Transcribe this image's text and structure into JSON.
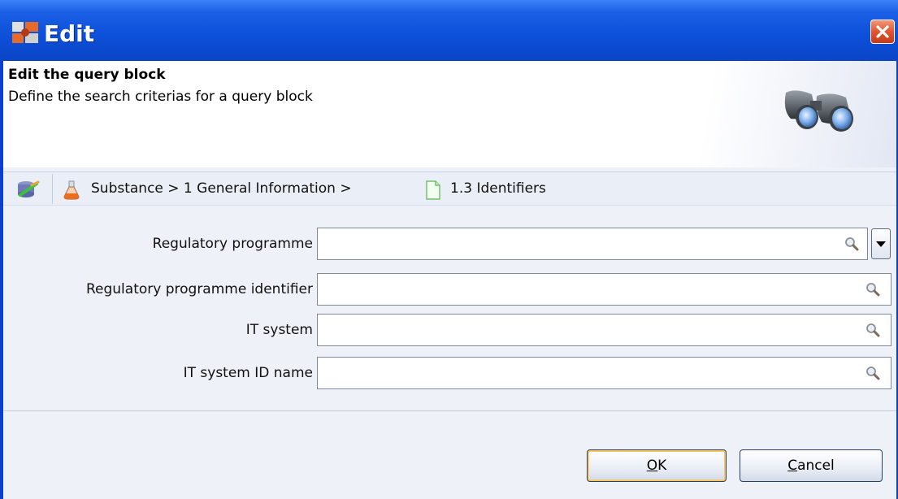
{
  "window": {
    "title": "Edit",
    "colors": {
      "titlebar": "#0c4fd8",
      "close": "#e0552f",
      "content": "#eef1f7"
    }
  },
  "header": {
    "title": "Edit the query block",
    "subtitle": "Define the search criterias for a query block"
  },
  "breadcrumb": {
    "path": "Substance > 1 General Information >",
    "current": "1.3 Identifiers"
  },
  "form": {
    "fields": [
      {
        "label": "Regulatory programme",
        "value": "",
        "has_dropdown": true
      },
      {
        "label": "Regulatory programme identifier",
        "value": ""
      },
      {
        "label": "IT system",
        "value": ""
      },
      {
        "label": "IT system ID name",
        "value": ""
      }
    ]
  },
  "buttons": {
    "ok": {
      "mnemonic": "O",
      "rest": "K"
    },
    "cancel": {
      "mnemonic": "C",
      "rest": "ancel"
    }
  },
  "icons": {
    "app": "app-logo-icon",
    "close": "close-icon",
    "binoculars": "binoculars-icon",
    "crumb_button": "database-icon",
    "flask": "flask-icon",
    "document": "document-icon",
    "search": "search-icon",
    "dropdown": "chevron-down-icon"
  }
}
